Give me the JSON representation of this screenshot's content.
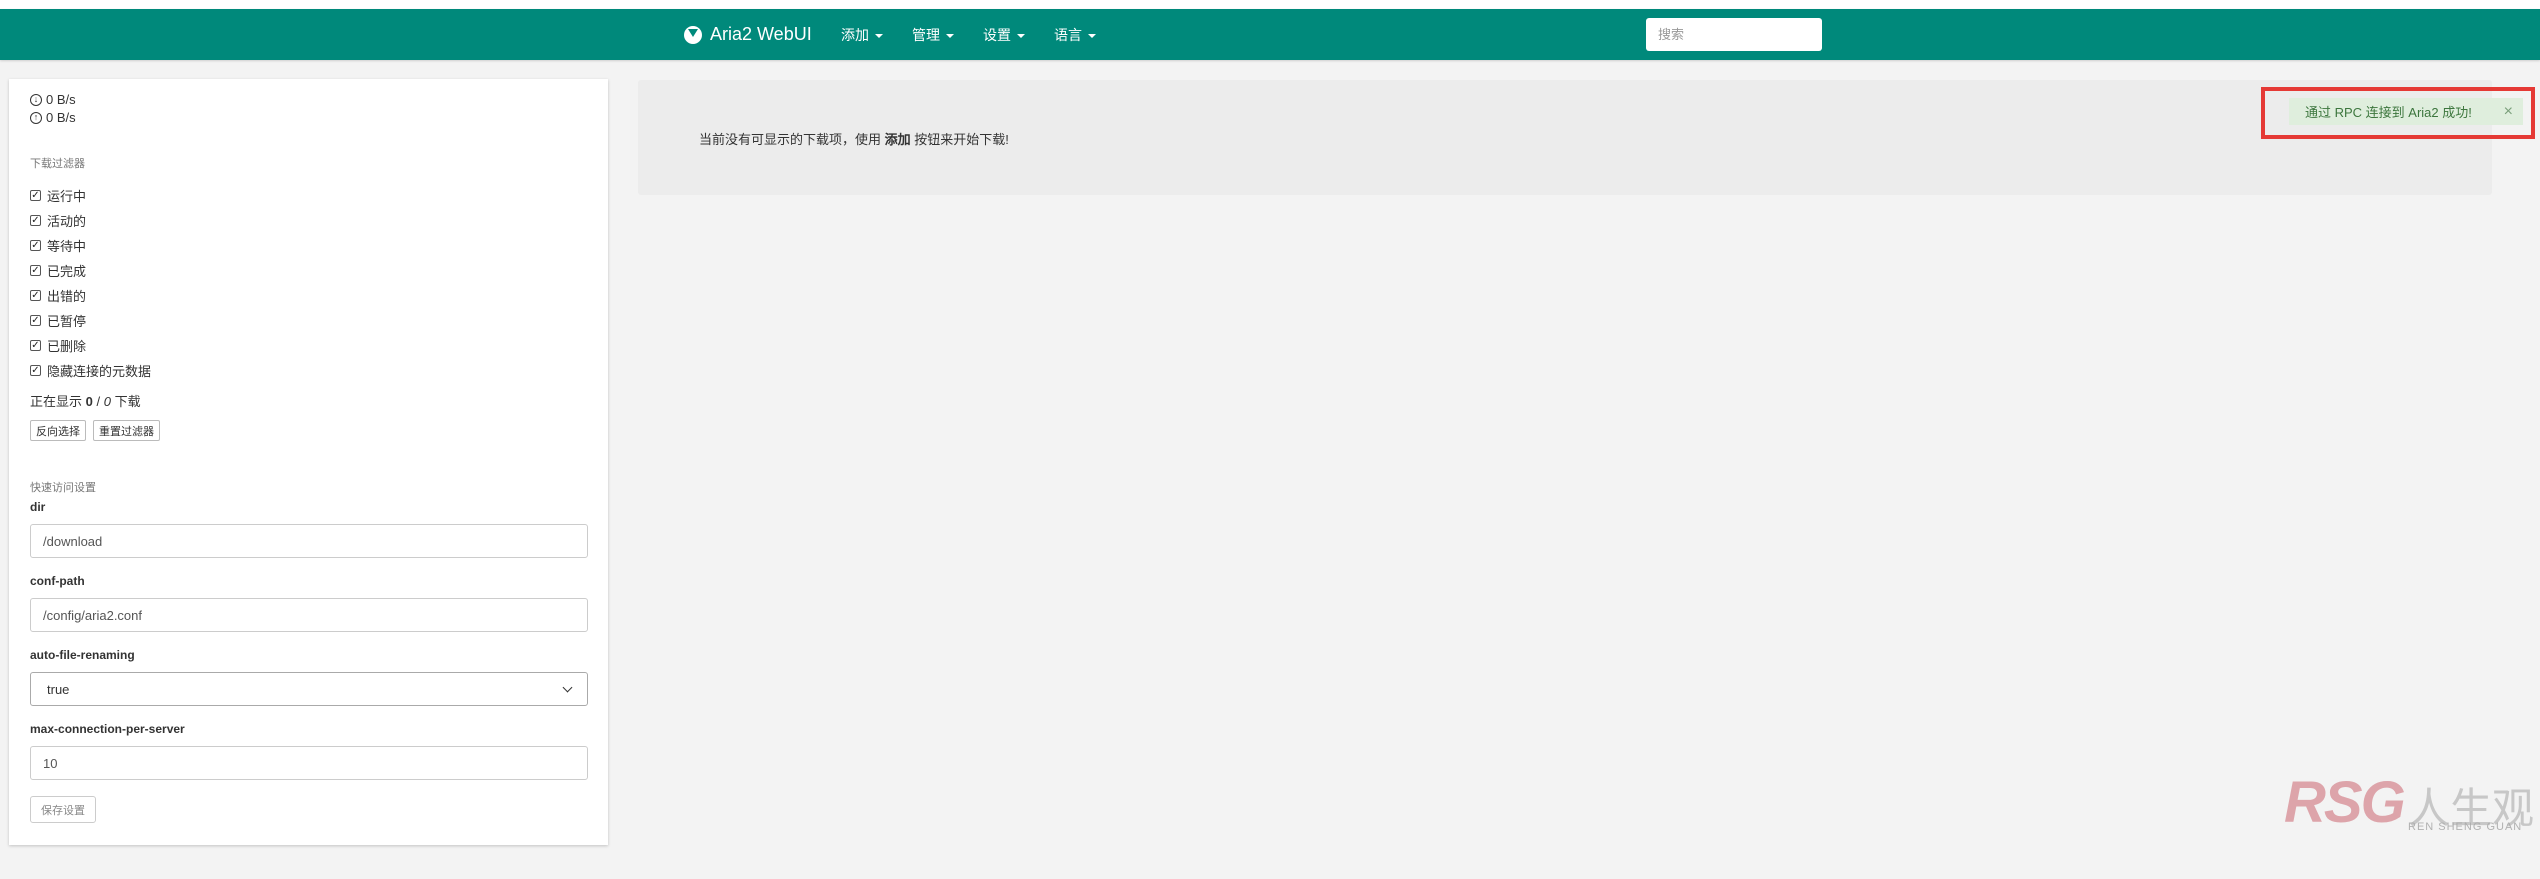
{
  "navbar": {
    "brand": "Aria2 WebUI",
    "menu": [
      {
        "label": "添加"
      },
      {
        "label": "管理"
      },
      {
        "label": "设置"
      },
      {
        "label": "语言"
      }
    ],
    "search_placeholder": "搜索"
  },
  "sidebar": {
    "download_speed": "0 B/s",
    "upload_speed": "0 B/s",
    "filter_title": "下载过滤器",
    "filters": [
      {
        "label": "运行中",
        "checked": true
      },
      {
        "label": "活动的",
        "checked": true
      },
      {
        "label": "等待中",
        "checked": true
      },
      {
        "label": "已完成",
        "checked": true
      },
      {
        "label": "出错的",
        "checked": true
      },
      {
        "label": "已暂停",
        "checked": true
      },
      {
        "label": "已删除",
        "checked": true
      },
      {
        "label": "隐藏连接的元数据",
        "checked": true
      }
    ],
    "showing_prefix": "正在显示",
    "showing_count": "0",
    "showing_sep": "/",
    "showing_total": "0",
    "showing_suffix": "下载",
    "invert_button": "反向选择",
    "reset_button": "重置过滤器",
    "quick_title": "快速访问设置",
    "fields": [
      {
        "label": "dir",
        "value": "/download"
      },
      {
        "label": "conf-path",
        "value": "/config/aria2.conf"
      },
      {
        "label": "auto-file-renaming",
        "value": "true"
      },
      {
        "label": "max-connection-per-server",
        "value": "10"
      }
    ],
    "save_button": "保存设置"
  },
  "main": {
    "empty_prefix": "当前没有可显示的下载项，使用",
    "empty_bold": "添加",
    "empty_suffix": "按钮来开始下载!"
  },
  "toast": {
    "message": "通过 RPC 连接到 Aria2 成功!",
    "close": "×"
  },
  "watermark": {
    "logo": "RSG",
    "chinese": "人生观",
    "english": "REN SHENG GUAN"
  },
  "colors": {
    "navbar": "#00897b",
    "toast_bg": "#dfeedd",
    "toast_text": "#3c763d",
    "highlight": "#e53935"
  }
}
